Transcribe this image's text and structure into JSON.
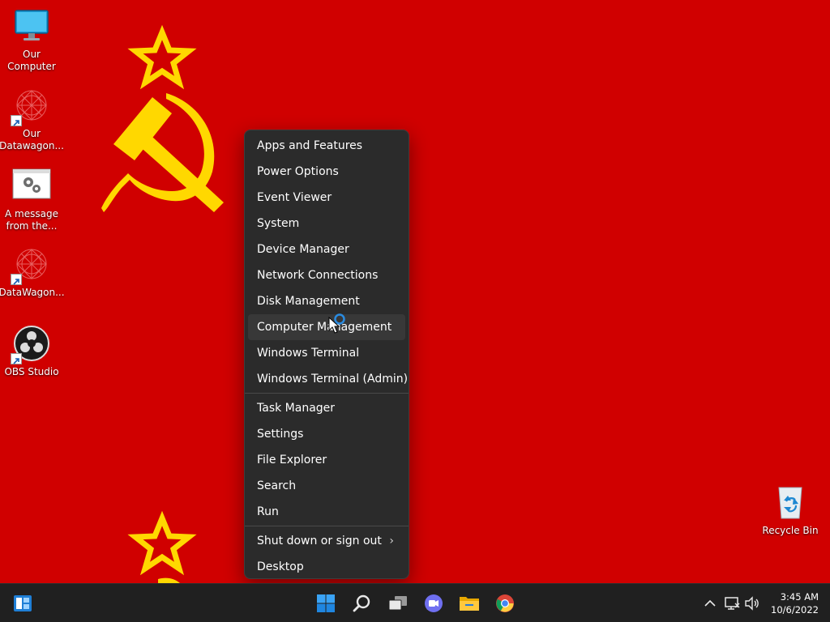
{
  "desktop": {
    "icons": [
      {
        "label_line1": "Our",
        "label_line2": "Computer",
        "icon": "monitor-icon"
      },
      {
        "label_line1": "Our",
        "label_line2": "Datawagon...",
        "icon": "datawagon-icon"
      },
      {
        "label_line1": "A message",
        "label_line2": "from the...",
        "icon": "settings-window-icon"
      },
      {
        "label_line1": "DataWagon...",
        "label_line2": "",
        "icon": "datawagon-icon"
      },
      {
        "label_line1": "OBS Studio",
        "label_line2": "",
        "icon": "obs-icon"
      }
    ],
    "recycle_bin": {
      "label": "Recycle Bin",
      "icon": "recycle-bin-icon"
    }
  },
  "context_menu": {
    "group1": [
      "Apps and Features",
      "Power Options",
      "Event Viewer",
      "System",
      "Device Manager",
      "Network Connections",
      "Disk Management",
      "Computer Management",
      "Windows Terminal",
      "Windows Terminal (Admin)"
    ],
    "group2": [
      "Task Manager",
      "Settings",
      "File Explorer",
      "Search",
      "Run"
    ],
    "group3": [
      "Shut down or sign out",
      "Desktop"
    ],
    "submenu_chevron": "›",
    "hovered_item": "Computer Management"
  },
  "taskbar": {
    "left_icon": "widgets-icon",
    "center_icons": [
      "windows-start-icon",
      "search-icon",
      "task-view-icon",
      "teams-chat-icon",
      "file-explorer-icon",
      "chrome-icon"
    ],
    "tray_icons": [
      "chevron-up-icon",
      "network-icon",
      "volume-icon"
    ],
    "time": "3:45 AM",
    "date": "10/6/2022"
  },
  "colors": {
    "wallpaper": "#d00000",
    "emblem": "#ffd800",
    "menu_bg": "#2b2b2b",
    "taskbar_bg": "#202020"
  }
}
